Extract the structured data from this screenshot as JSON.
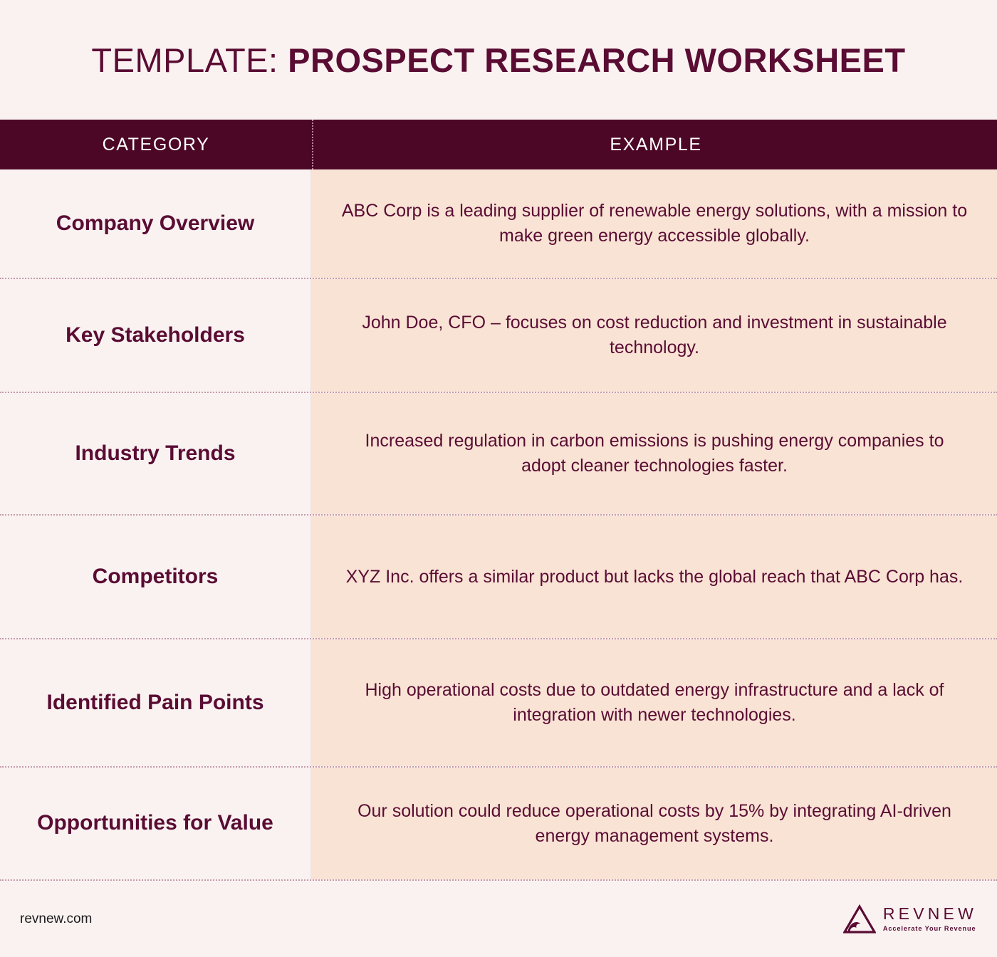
{
  "document": {
    "title_prefix": "TEMPLATE:",
    "title_main": "PROSPECT RESEARCH WORKSHEET",
    "accent_dark": "#4d0726",
    "accent_text": "#5a0c33",
    "page_bg": "#f9f2f1",
    "example_bg": "#f9e3d5",
    "divider_color": "#c79aac"
  },
  "table": {
    "headers": {
      "category": "CATEGORY",
      "example": "EXAMPLE"
    },
    "rows": [
      {
        "category": "Company Overview",
        "example": "ABC Corp is a leading supplier of renewable energy solutions, with a mission to make green energy accessible globally."
      },
      {
        "category": "Key Stakeholders",
        "example": "John Doe, CFO – focuses on cost reduction and investment in sustainable technology."
      },
      {
        "category": "Industry Trends",
        "example": "Increased regulation in carbon emissions is pushing energy companies to adopt cleaner technologies faster."
      },
      {
        "category": "Competitors",
        "example": "XYZ Inc. offers a similar product but lacks the global reach that ABC Corp has."
      },
      {
        "category": "Identified Pain Points",
        "example": "High operational costs due to outdated energy infrastructure and a lack of integration with newer technologies."
      },
      {
        "category": "Opportunities for Value",
        "example": "Our solution could reduce operational costs by 15% by integrating AI-driven energy management systems."
      }
    ]
  },
  "footer": {
    "website": "revnew.com",
    "logo": {
      "name": "REVNEW",
      "tagline": "Accelerate Your Revenue",
      "mark": "triangle-wave-icon"
    }
  }
}
